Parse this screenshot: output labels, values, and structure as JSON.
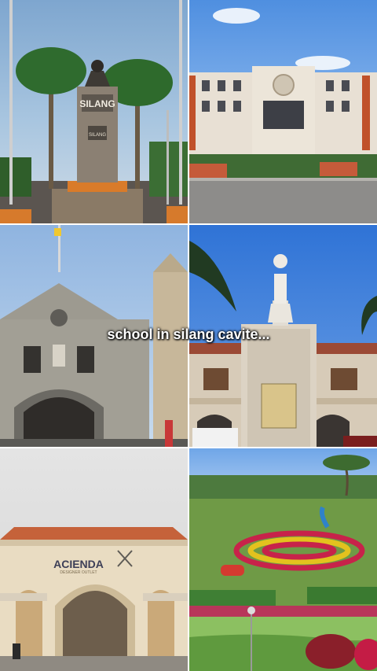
{
  "caption": "school in silang cavite...",
  "photos": [
    {
      "name": "silang-monument",
      "sign_text": "SILANG",
      "plaque_text": "SILANG"
    },
    {
      "name": "municipal-building"
    },
    {
      "name": "stone-church"
    },
    {
      "name": "rizal-statue-plaza"
    },
    {
      "name": "acienda-outlet",
      "sign_text": "ACIENDA",
      "sign_subtext": "DESIGNER OUTLET"
    },
    {
      "name": "flower-garden-park"
    }
  ],
  "colors": {
    "caption_text": "#ffffff",
    "caption_shadow": "#000000"
  }
}
